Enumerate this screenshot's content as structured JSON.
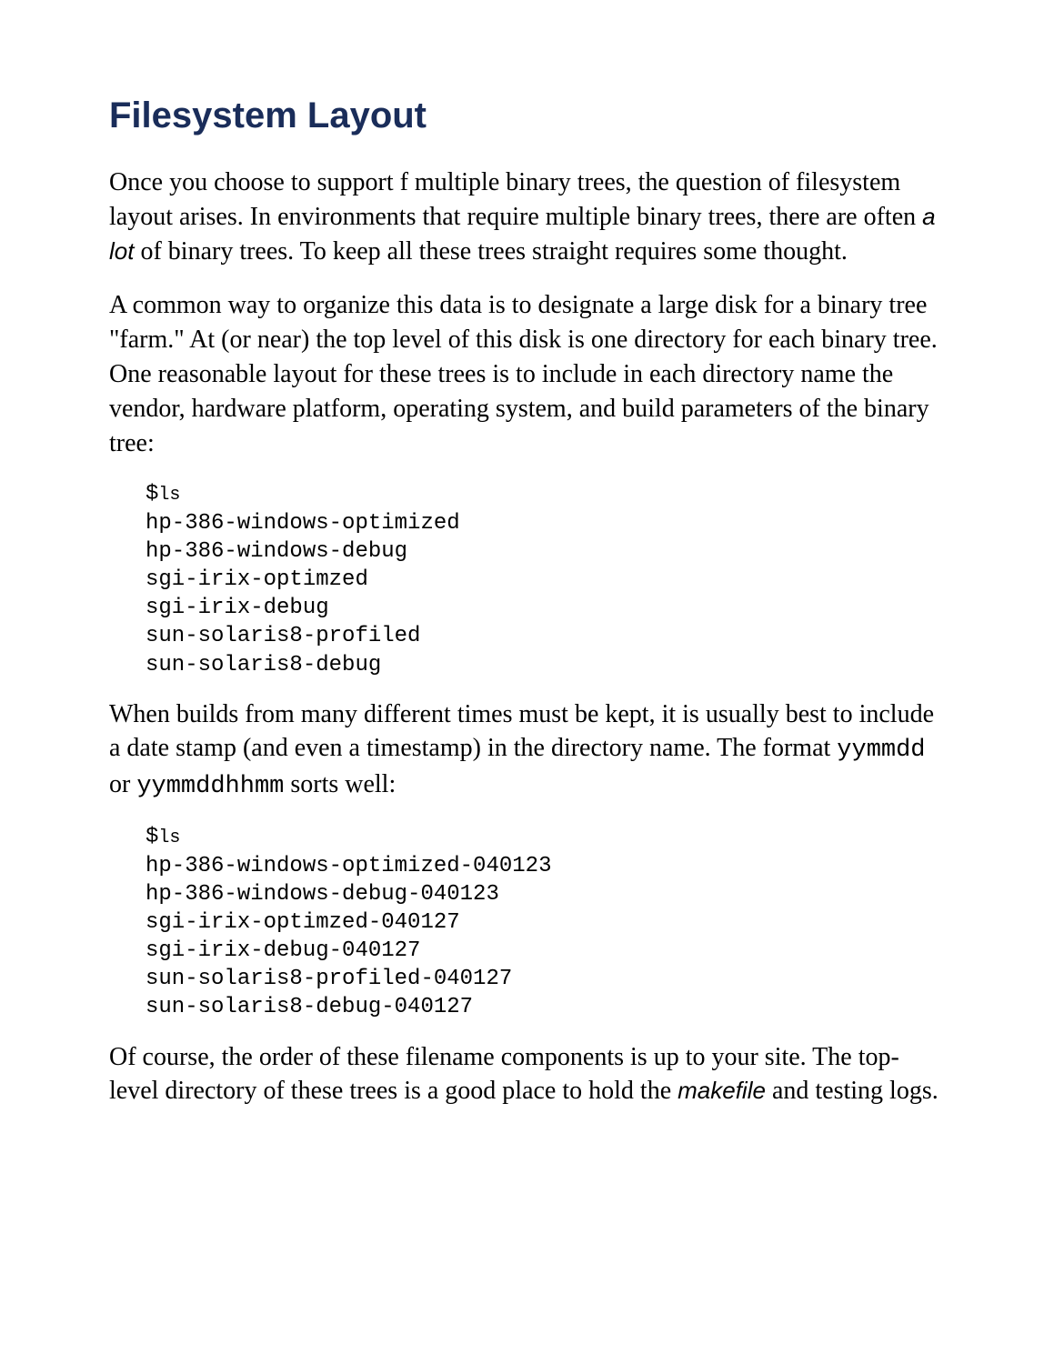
{
  "heading": "Filesystem Layout",
  "para1_before": "Once you choose to support f multiple binary trees, the question of filesystem layout arises. In environments that require multiple binary trees, there are often ",
  "para1_italic": "a lot",
  "para1_after": " of binary trees. To keep all these trees straight requires some thought.",
  "para2": "A common way to organize this data is to designate a large disk for a binary tree \"farm.\" At (or near) the top level of this disk is one directory for each binary tree. One reasonable layout for these trees is to include in each directory name the vendor, hardware platform, operating system, and build parameters of the binary tree:",
  "code1_prompt": "$",
  "code1_cmd": "ls",
  "code1_lines": "hp-386-windows-optimized\nhp-386-windows-debug\nsgi-irix-optimzed\nsgi-irix-debug\nsun-solaris8-profiled\nsun-solaris8-debug",
  "para3_before": "When builds from many different times must be kept, it is usually best to include a date stamp (and even a timestamp) in the directory name. The format ",
  "para3_mono1": "yymmdd",
  "para3_mid": " or ",
  "para3_mono2": "yymmddhhmm",
  "para3_after": " sorts well:",
  "code2_prompt": "$",
  "code2_cmd": "ls",
  "code2_lines": "hp-386-windows-optimized-040123\nhp-386-windows-debug-040123\nsgi-irix-optimzed-040127\nsgi-irix-debug-040127\nsun-solaris8-profiled-040127\nsun-solaris8-debug-040127",
  "para4_before": "Of course, the order of these filename components is up to your site. The top-level directory of these trees is a good place to hold the ",
  "para4_italic": "makefile",
  "para4_after": " and testing logs."
}
